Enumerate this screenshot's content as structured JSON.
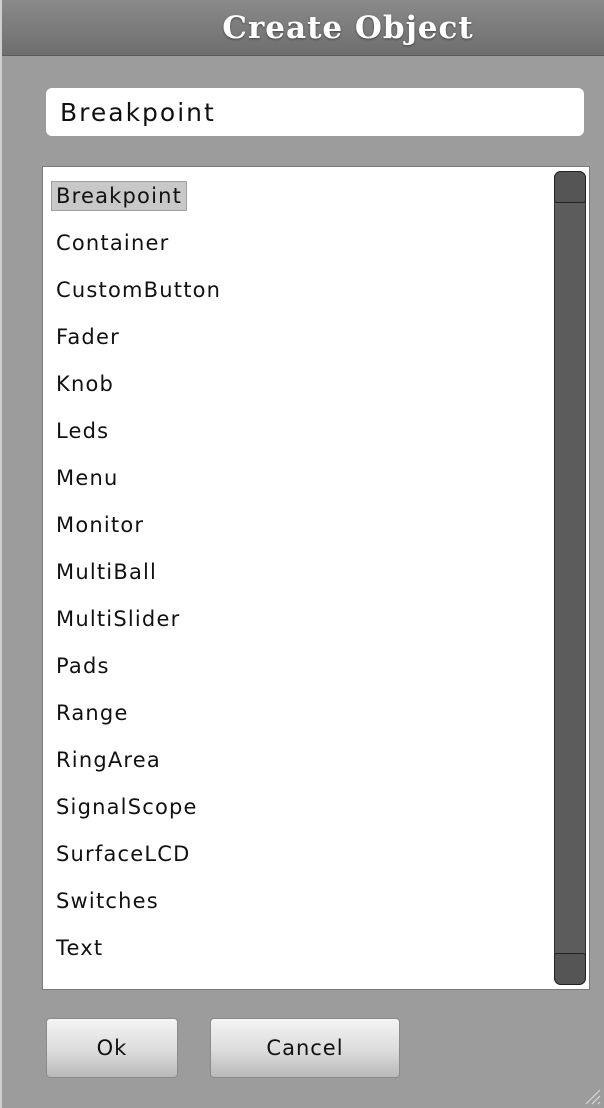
{
  "dialog": {
    "title": "Create Object",
    "search": {
      "value": "Breakpoint",
      "placeholder": ""
    },
    "list": {
      "items": [
        "Breakpoint",
        "Container",
        "CustomButton",
        "Fader",
        "Knob",
        "Leds",
        "Menu",
        "Monitor",
        "MultiBall",
        "MultiSlider",
        "Pads",
        "Range",
        "RingArea",
        "SignalScope",
        "SurfaceLCD",
        "Switches",
        "Text"
      ],
      "selected_index": 0
    },
    "buttons": {
      "ok_label": "Ok",
      "cancel_label": "Cancel"
    }
  },
  "colors": {
    "dialog_background": "#9c9c9c",
    "title_bar": "#7c7c7c",
    "selection": "#c8c8c8",
    "scrollbar": "#5c5c5c"
  },
  "icons": {
    "resize_grip": "resize-grip-icon"
  }
}
